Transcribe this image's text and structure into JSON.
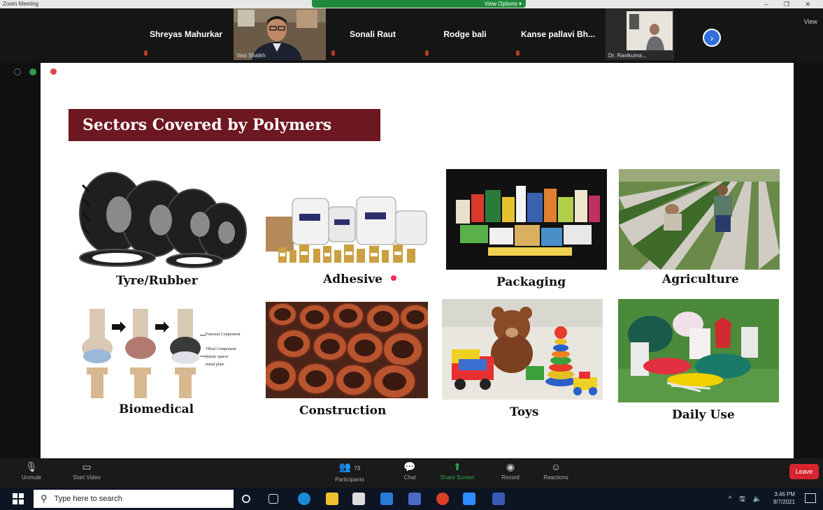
{
  "titlebar": {
    "app_label": "Zoom Meeting",
    "view_options": "View Options ▾",
    "window_controls": "– ❐ ✕"
  },
  "participants_strip": {
    "tiles": [
      {
        "name": "Shreyas Mahurkar"
      },
      {
        "name": "Vasi Shaikh",
        "video": true
      },
      {
        "name": "Sonali Raut"
      },
      {
        "name": "Rodge bali"
      },
      {
        "name": "Kanse pallavi Bh..."
      },
      {
        "name": "Dr. Ravikuma...",
        "video": true
      }
    ],
    "view_label": "View",
    "next_icon": "chevron-right-icon"
  },
  "slide": {
    "title": "Sectors Covered by Polymers",
    "sectors": [
      {
        "label": "Tyre/Rubber",
        "icon": "tyre-image"
      },
      {
        "label": "Adhesive",
        "icon": "adhesive-image"
      },
      {
        "label": "Packaging",
        "icon": "packaging-image"
      },
      {
        "label": "Agriculture",
        "icon": "agriculture-image"
      },
      {
        "label": "Biomedical",
        "icon": "biomedical-image"
      },
      {
        "label": "Construction",
        "icon": "construction-image"
      },
      {
        "label": "Toys",
        "icon": "toys-image"
      },
      {
        "label": "Daily Use",
        "icon": "daily-use-image"
      }
    ],
    "biomedical_notes": [
      "Femoral Component",
      "Tibial Component",
      "plastic spacer",
      "metal plate"
    ]
  },
  "meeting_controls": {
    "unmute": "Unmute",
    "start_video": "Start Video",
    "participants": "Participants",
    "participants_count": "73",
    "chat": "Chat",
    "share_screen": "Share Screen",
    "record": "Record",
    "reactions": "Reactions",
    "leave": "Leave"
  },
  "taskbar": {
    "search_placeholder": "Type here to search",
    "time": "3:46 PM",
    "date": "9/7/2021",
    "tray": "^ 🖫 🔈"
  },
  "colors": {
    "title_bg": "#6d1720",
    "leave_red": "#d5252f",
    "next_blue": "#2f6fd9",
    "view_options_green": "#1f8b3a"
  }
}
